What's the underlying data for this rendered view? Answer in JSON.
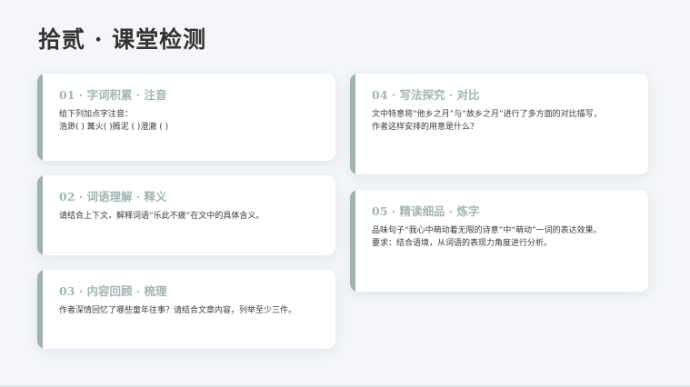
{
  "page": {
    "title": "拾贰 · 课堂检测"
  },
  "cards": [
    {
      "title": "01 · 字词积累 · 注音",
      "lines": [
        "给下列加点字注音：",
        "浩渺( ) 篝火( )腾泥 ( )澄澈 ( )"
      ]
    },
    {
      "title": "02 · 词语理解 · 释义",
      "lines": [
        "请结合上下文，解释词语“乐此不疲”在文中的具体含义。"
      ]
    },
    {
      "title": "03 · 内容回顾 · 梳理",
      "lines": [
        "作者深情回忆了哪些童年往事？请结合文章内容，列举至少三件。"
      ]
    },
    {
      "title": "04 · 写法探究 · 对比",
      "lines": [
        "文中特意将“他乡之月”与“故乡之月”进行了多方面的对比描写，",
        "作者这样安排的用意是什么？"
      ]
    },
    {
      "title": "05 · 精读细品 · 炼字",
      "lines": [
        "品味句子“我心中萌动着无限的诗意”中“萌动”一词的表达效果。",
        "要求：结合语境，从词语的表现力角度进行分析。"
      ]
    }
  ],
  "colors": {
    "background": "#f4f6f9",
    "accent_bar": "#9fb0ad",
    "card_title": "#a3b5b2",
    "page_title": "#333333",
    "body_text": "#3a3a3a"
  }
}
